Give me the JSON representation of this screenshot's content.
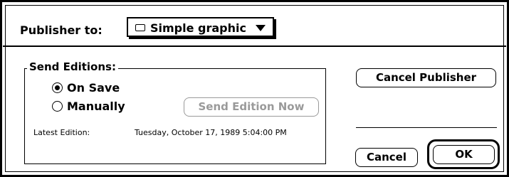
{
  "dialog": {
    "publisher_label": "Publisher to:",
    "publisher_target": {
      "icon": "document-icon",
      "value": "Simple graphic"
    },
    "send_editions": {
      "title": "Send Editions:",
      "options": [
        {
          "label": "On Save",
          "selected": true
        },
        {
          "label": "Manually",
          "selected": false
        }
      ],
      "send_now_label": "Send Edition Now",
      "send_now_enabled": false,
      "latest_edition_label": "Latest Edition:",
      "latest_edition_value": "Tuesday, October 17, 1989 5:04:00 PM"
    },
    "buttons": {
      "cancel_publisher": "Cancel Publisher",
      "cancel": "Cancel",
      "ok": "OK",
      "default": "OK"
    }
  }
}
